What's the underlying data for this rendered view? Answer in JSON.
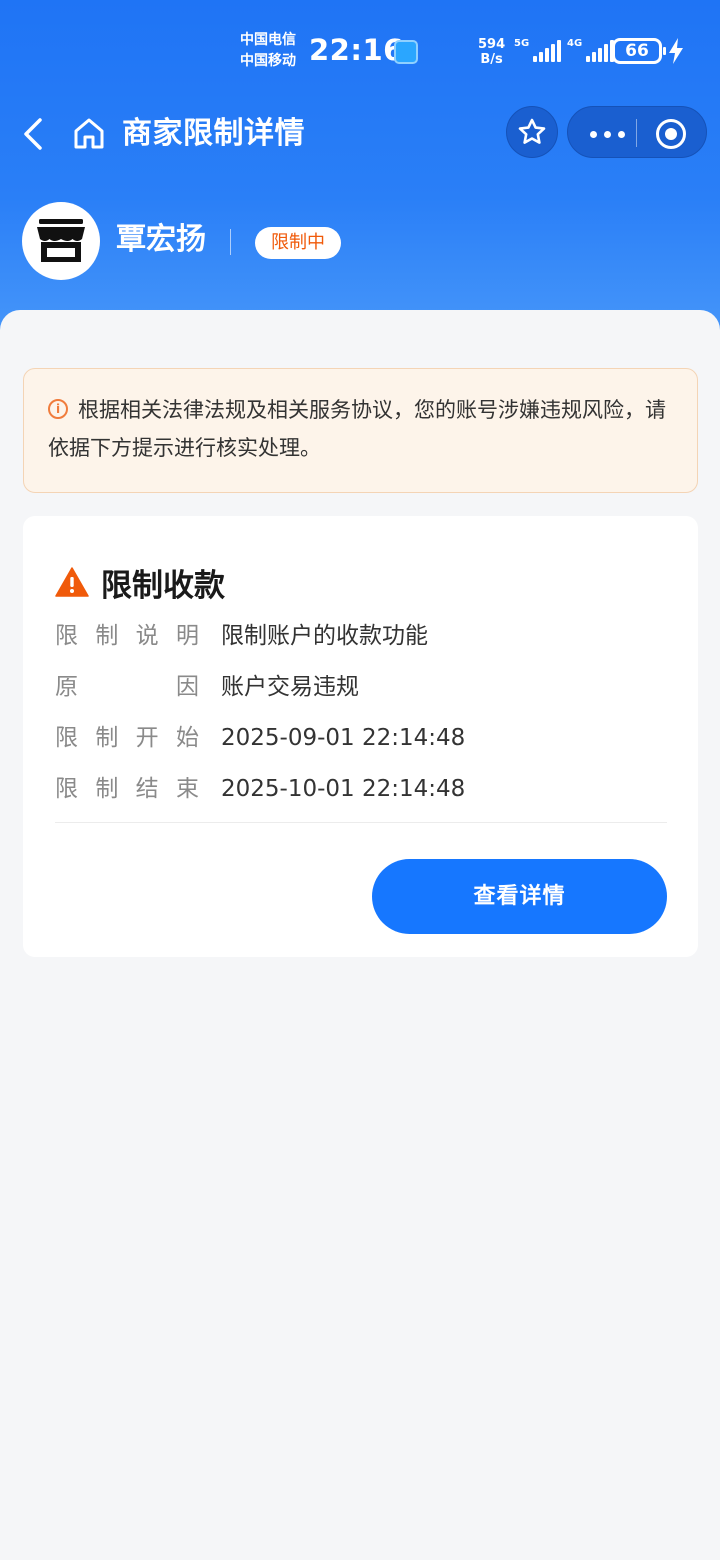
{
  "status_bar": {
    "carrier_1": "中国电信",
    "carrier_2": "中国移动",
    "time": "22:16",
    "net_speed_value": "594",
    "net_speed_unit": "B/s",
    "signal_1_label": "5G",
    "signal_2_label": "4G",
    "battery": "66"
  },
  "navbar": {
    "title": "商家限制详情"
  },
  "merchant": {
    "name": "覃宏扬",
    "status_tag": "限制中"
  },
  "notice": {
    "text": "根据相关法律法规及相关服务协议，您的账号涉嫌违规风险，请依据下方提示进行核实处理。"
  },
  "restriction": {
    "title": "限制收款",
    "rows": [
      {
        "key_chars": [
          "限",
          "制",
          "说",
          "明"
        ],
        "value": "限制账户的收款功能"
      },
      {
        "key_chars": [
          "原",
          "因"
        ],
        "value": "账户交易违规"
      },
      {
        "key_chars": [
          "限",
          "制",
          "开",
          "始"
        ],
        "value": "2025-09-01 22:14:48"
      },
      {
        "key_chars": [
          "限",
          "制",
          "结",
          "束"
        ],
        "value": "2025-10-01 22:14:48"
      }
    ],
    "button_label": "查看详情"
  },
  "colors": {
    "brand_blue": "#1677ff",
    "warning_orange": "#f05a0a",
    "notice_bg": "#fdf4ea"
  }
}
